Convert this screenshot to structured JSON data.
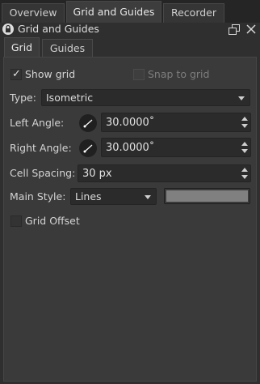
{
  "top_tabs": [
    "Overview",
    "Grid and Guides",
    "Recorder"
  ],
  "docker": {
    "title": "Grid and Guides"
  },
  "sub_tabs": [
    "Grid",
    "Guides"
  ],
  "grid": {
    "show_grid_label": "Show grid",
    "show_grid_checked": true,
    "snap_label": "Snap to grid",
    "snap_checked": false,
    "type_label": "Type:",
    "type_value": "Isometric",
    "left_angle_label": "Left Angle:",
    "left_angle_value": "30.0000˚",
    "right_angle_label": "Right Angle:",
    "right_angle_value": "30.0000˚",
    "cell_spacing_label": "Cell Spacing:",
    "cell_spacing_value": "30 px",
    "main_style_label": "Main Style:",
    "main_style_value": "Lines",
    "main_color": "#808080",
    "grid_offset_label": "Grid Offset",
    "grid_offset_checked": false
  },
  "icons": {
    "check": "✓",
    "lock": "lock-icon",
    "float": "float-icon",
    "close": "close-icon"
  }
}
